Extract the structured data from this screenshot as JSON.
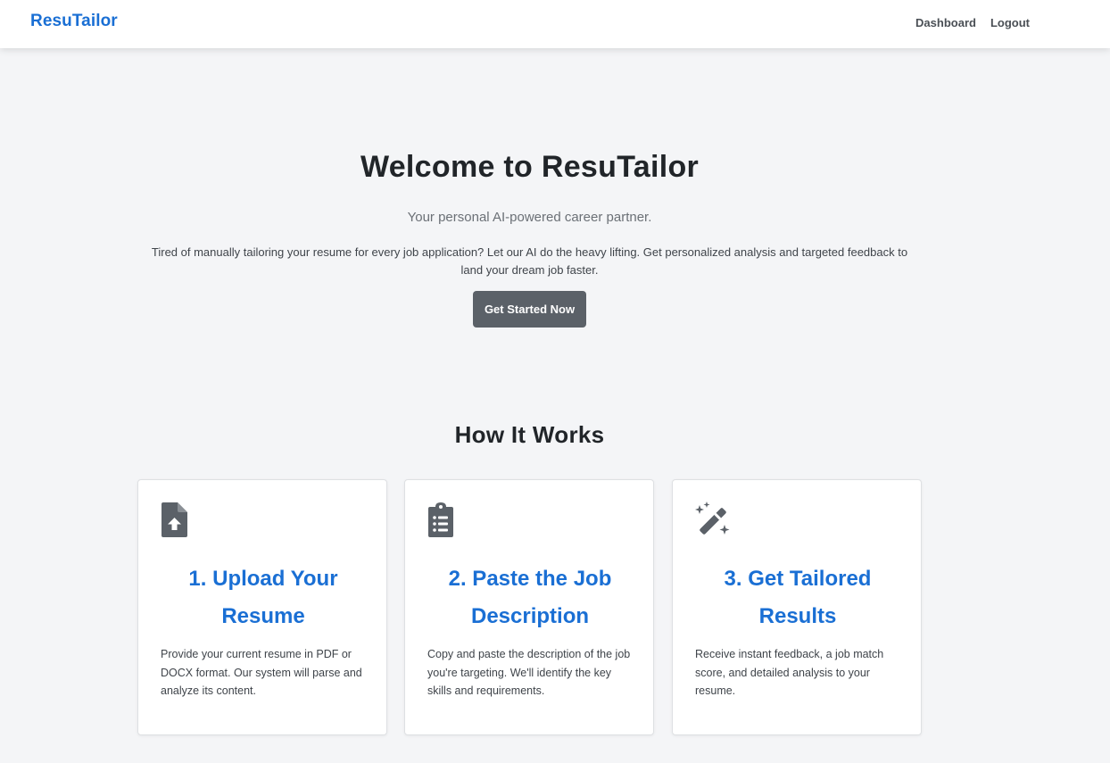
{
  "nav": {
    "brand": "ResuTailor",
    "links": [
      "Dashboard",
      "Logout"
    ]
  },
  "hero": {
    "title": "Welcome to ResuTailor",
    "subtitle": "Your personal AI-powered career partner.",
    "text": "Tired of manually tailoring your resume for every job application? Let our AI do the heavy lifting. Get personalized analysis and targeted feedback to land your dream job faster.",
    "cta_label": "Get Started Now"
  },
  "how_it_works": {
    "title": "How It Works",
    "cards": [
      {
        "icon": "file-upload-icon",
        "title": "1. Upload Your Resume",
        "text": "Provide your current resume in PDF or DOCX format. Our system will parse and analyze its content."
      },
      {
        "icon": "clipboard-list-icon",
        "title": "2. Paste the Job Description",
        "text": "Copy and paste the description of the job you're targeting. We'll identify the key skills and requirements."
      },
      {
        "icon": "magic-wand-icon",
        "title": "3. Get Tailored Results",
        "text": "Receive instant feedback, a job match score, and detailed analysis to your resume."
      }
    ]
  },
  "colors": {
    "brand": "#1a6fd4",
    "button": "#5b6168",
    "icon": "#5b6168",
    "background": "#f4f5f7"
  }
}
